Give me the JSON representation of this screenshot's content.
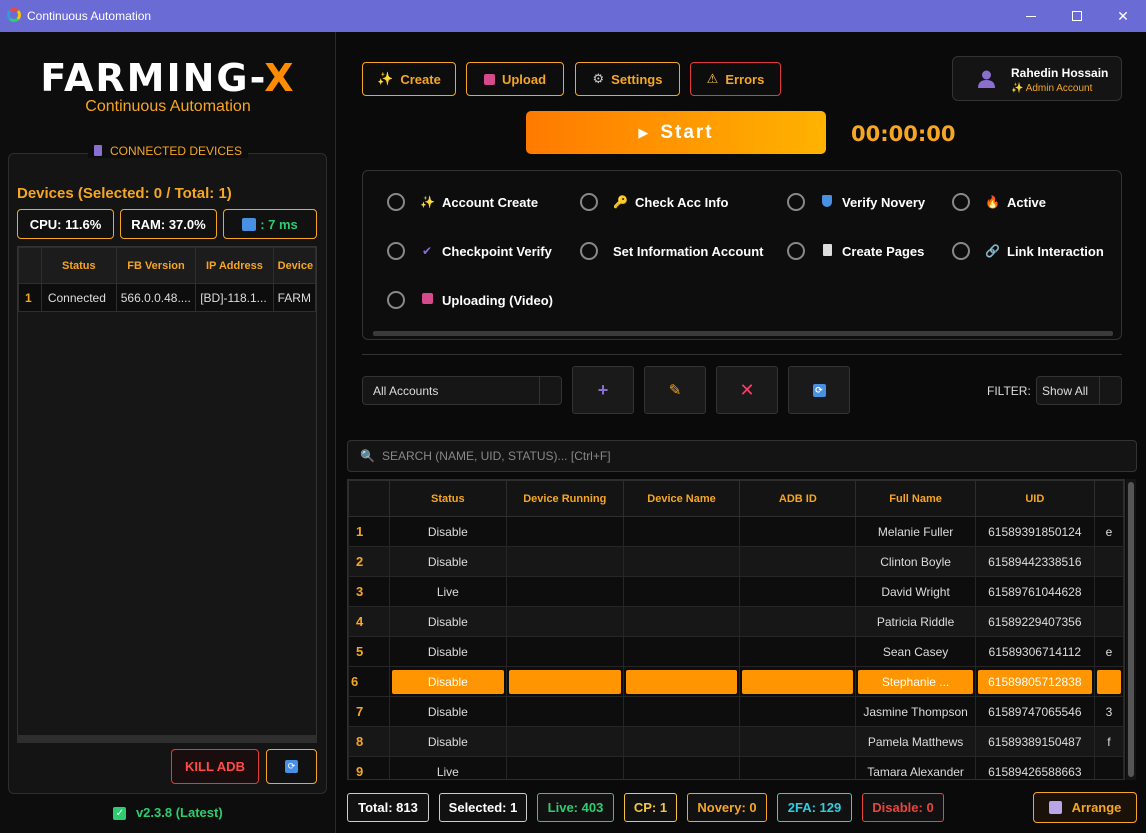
{
  "window": {
    "title": "Continuous Automation"
  },
  "sidebar": {
    "logo_main": "FARMING-",
    "logo_x": "X",
    "logo_sub": "Continuous Automation",
    "section_title": "CONNECTED DEVICES",
    "device_count": "Devices (Selected: 0 / Total: 1)",
    "cpu": "CPU: 11.6%",
    "ram": "RAM: 37.0%",
    "ping": ": 7 ms",
    "device_table": {
      "headers": [
        "",
        "Status",
        "FB Version",
        "IP Address",
        "Device"
      ],
      "rows": [
        [
          "1",
          "Connected",
          "566.0.0.48....",
          "[BD]-118.1...",
          "FARM"
        ]
      ]
    },
    "kill_adb": "KILL ADB",
    "version": "v2.3.8 (Latest)"
  },
  "toolbar": {
    "create": "Create",
    "upload": "Upload",
    "settings": "Settings",
    "errors": "Errors"
  },
  "user": {
    "name": "Rahedin Hossain",
    "role": "Admin Account"
  },
  "start_label": "Start",
  "timer": "00:00:00",
  "tasks": {
    "account_create": "Account Create",
    "check_acc_info": "Check Acc Info",
    "verify_novery": "Verify Novery",
    "active": "Active",
    "checkpoint_verify": "Checkpoint Verify",
    "set_information_account": "Set Information Account",
    "create_pages": "Create Pages",
    "link_interaction": "Link Interaction",
    "uploading_video": "Uploading (Video)"
  },
  "accounts_select": "All Accounts",
  "filter": {
    "label": "FILTER:",
    "value": "Show All"
  },
  "search_placeholder": "SEARCH (NAME, UID, STATUS)... [Ctrl+F]",
  "accounts_table": {
    "headers": [
      "",
      "Status",
      "Device Running",
      "Device Name",
      "ADB ID",
      "Full Name",
      "UID",
      ""
    ],
    "rows": [
      {
        "num": "1",
        "status": "Disable",
        "name": "Melanie Fuller",
        "uid": "61589391850124",
        "extra": "e"
      },
      {
        "num": "2",
        "status": "Disable",
        "name": "Clinton Boyle",
        "uid": "61589442338516",
        "extra": ""
      },
      {
        "num": "3",
        "status": "Live",
        "name": "David Wright",
        "uid": "61589761044628",
        "extra": ""
      },
      {
        "num": "4",
        "status": "Disable",
        "name": "Patricia Riddle",
        "uid": "61589229407356",
        "extra": ""
      },
      {
        "num": "5",
        "status": "Disable",
        "name": "Sean Casey",
        "uid": "61589306714112",
        "extra": "e"
      },
      {
        "num": "6",
        "status": "Disable",
        "name": "Stephanie ...",
        "uid": "61589805712838",
        "extra": ""
      },
      {
        "num": "7",
        "status": "Disable",
        "name": "Jasmine Thompson",
        "uid": "61589747065546",
        "extra": "3"
      },
      {
        "num": "8",
        "status": "Disable",
        "name": "Pamela Matthews",
        "uid": "61589389150487",
        "extra": "f"
      },
      {
        "num": "9",
        "status": "Live",
        "name": "Tamara Alexander",
        "uid": "61589426588663",
        "extra": ""
      }
    ]
  },
  "status_bar": {
    "total": "Total: 813",
    "selected": "Selected: 1",
    "live": "Live: 403",
    "cp": "CP: 1",
    "novery": "Novery: 0",
    "twofa": "2FA: 129",
    "disable": "Disable: 0",
    "arrange": "Arrange"
  },
  "colors": {
    "accent": "#f5a623",
    "live": "#2ecc71",
    "disable": "#e8453c",
    "titlebar": "#6b6bd6"
  }
}
